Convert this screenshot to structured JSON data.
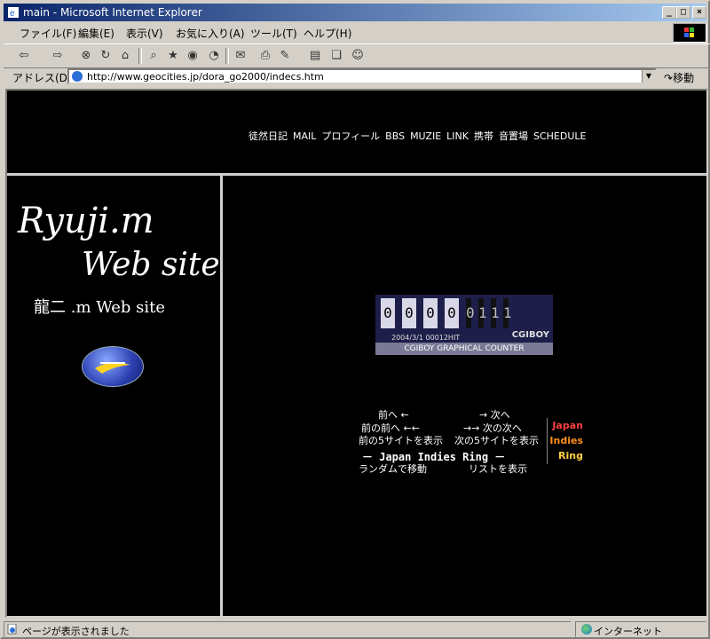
{
  "window": {
    "title": "main - Microsoft Internet Explorer",
    "buttons": {
      "minimize": "_",
      "maximize": "□",
      "close": "×"
    }
  },
  "menu": {
    "items": [
      "ファイル(F)",
      "編集(E)",
      "表示(V)",
      "お気に入り(A)",
      "ツール(T)",
      "ヘルプ(H)"
    ]
  },
  "address": {
    "label": "アドレス(D)",
    "url": "http://www.geocities.jp/dora_go2000/indecs.htm",
    "go_label": "移動"
  },
  "top_nav": {
    "links": [
      "徒然日記",
      "MAIL",
      "プロフィール",
      "BBS",
      "MUZIE",
      "LINK",
      "携帯",
      "音置場",
      "SCHEDULE"
    ]
  },
  "left": {
    "logo_line1": "Ryuji.m",
    "logo_line2": "Web site",
    "subtitle": "龍二 .m Web site"
  },
  "counter": {
    "digits": [
      "0",
      "0",
      "0",
      "0",
      "0",
      "1",
      "1",
      "1"
    ],
    "info": "2004/3/1  00012HIT",
    "brand": "CGIBOY",
    "caption": "CGIBOY GRAPHICAL COUNTER"
  },
  "webring": {
    "prev": "前へ ←",
    "next": "→ 次へ",
    "prev2": "前の前へ ←←",
    "next2": "→→ 次の次へ",
    "prev5": "前の5サイトを表示",
    "next5": "次の5サイトを表示",
    "title": "－ Japan Indies Ring －",
    "random": "ランダムで移動",
    "list": "リストを表示",
    "badge": [
      "Japan",
      "Indies",
      "Ring"
    ],
    "badge_colors": [
      "#ff4040",
      "#ff9020",
      "#ffd040"
    ]
  },
  "status": {
    "text": "ページが表示されました",
    "zone": "インターネット"
  }
}
